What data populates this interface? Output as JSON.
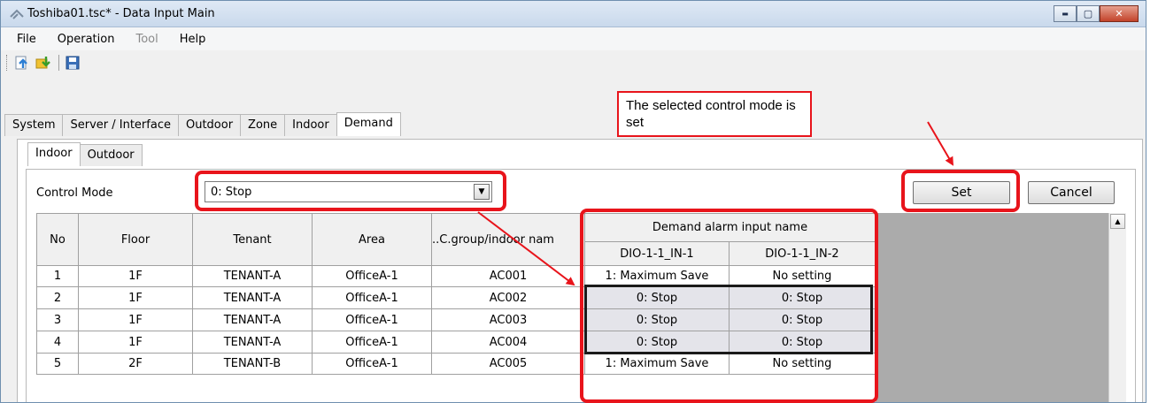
{
  "window": {
    "title": "Toshiba01.tsc* - Data Input Main",
    "buttons": {
      "minimize": "▬",
      "maximize": "▢",
      "close": "✕"
    }
  },
  "menu": [
    {
      "label": "File",
      "enabled": true
    },
    {
      "label": "Operation",
      "enabled": true
    },
    {
      "label": "Tool",
      "enabled": false
    },
    {
      "label": "Help",
      "enabled": true
    }
  ],
  "toolbar": {
    "icons": [
      "upload-icon",
      "download-icon",
      "save-icon"
    ]
  },
  "main_tabs": [
    "System",
    "Server / Interface",
    "Outdoor",
    "Zone",
    "Indoor",
    "Demand"
  ],
  "main_tab_active": "Demand",
  "sub_tabs": [
    "Indoor",
    "Outdoor"
  ],
  "sub_tab_active": "Indoor",
  "control_mode": {
    "label": "Control Mode",
    "value": "0: Stop"
  },
  "actions": {
    "set": "Set",
    "cancel": "Cancel"
  },
  "table": {
    "headers": {
      "no": "No",
      "floor": "Floor",
      "tenant": "Tenant",
      "area": "Area",
      "group": "..C.group/indoor nam",
      "demand_group": "Demand alarm input name",
      "in1": "DIO-1-1_IN-1",
      "in2": "DIO-1-1_IN-2"
    },
    "rows": [
      {
        "no": "1",
        "floor": "1F",
        "tenant": "TENANT-A",
        "area": "OfficeA-1",
        "group": "AC001",
        "in1": "1: Maximum Save",
        "in2": "No setting"
      },
      {
        "no": "2",
        "floor": "1F",
        "tenant": "TENANT-A",
        "area": "OfficeA-1",
        "group": "AC002",
        "in1": "0: Stop",
        "in2": "0: Stop"
      },
      {
        "no": "3",
        "floor": "1F",
        "tenant": "TENANT-A",
        "area": "OfficeA-1",
        "group": "AC003",
        "in1": "0: Stop",
        "in2": "0: Stop"
      },
      {
        "no": "4",
        "floor": "1F",
        "tenant": "TENANT-A",
        "area": "OfficeA-1",
        "group": "AC004",
        "in1": "0: Stop",
        "in2": "0: Stop"
      },
      {
        "no": "5",
        "floor": "2F",
        "tenant": "TENANT-B",
        "area": "OfficeA-1",
        "group": "AC005",
        "in1": "1: Maximum Save",
        "in2": "No setting"
      }
    ]
  },
  "annotation": {
    "text": "The selected control mode is set"
  },
  "colors": {
    "highlight": "#e8141b",
    "selected_cell": "#e4e4ea"
  }
}
